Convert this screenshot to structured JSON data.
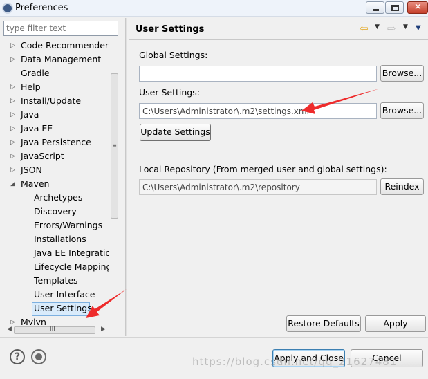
{
  "window": {
    "title": "Preferences"
  },
  "sidebar": {
    "filter_placeholder": "type filter text",
    "items": [
      {
        "label": "Code Recommenders",
        "arrow": "▷"
      },
      {
        "label": "Data Management",
        "arrow": "▷"
      },
      {
        "label": "Gradle",
        "arrow": ""
      },
      {
        "label": "Help",
        "arrow": "▷"
      },
      {
        "label": "Install/Update",
        "arrow": "▷"
      },
      {
        "label": "Java",
        "arrow": "▷"
      },
      {
        "label": "Java EE",
        "arrow": "▷"
      },
      {
        "label": "Java Persistence",
        "arrow": "▷"
      },
      {
        "label": "JavaScript",
        "arrow": "▷"
      },
      {
        "label": "JSON",
        "arrow": "▷"
      },
      {
        "label": "Maven",
        "arrow": "◢"
      },
      {
        "label": "Archetypes",
        "arrow": ""
      },
      {
        "label": "Discovery",
        "arrow": ""
      },
      {
        "label": "Errors/Warnings",
        "arrow": ""
      },
      {
        "label": "Installations",
        "arrow": ""
      },
      {
        "label": "Java EE Integration",
        "arrow": ""
      },
      {
        "label": "Lifecycle Mappings",
        "arrow": ""
      },
      {
        "label": "Templates",
        "arrow": ""
      },
      {
        "label": "User Interface",
        "arrow": ""
      },
      {
        "label": "User Settings",
        "arrow": ""
      },
      {
        "label": "Mylyn",
        "arrow": "▷"
      }
    ],
    "selected": "User Settings"
  },
  "main": {
    "page_title": "User Settings",
    "global_settings_label": "Global Settings:",
    "global_settings_value": "",
    "browse_label": "Browse...",
    "user_settings_label": "User Settings:",
    "user_settings_value": "C:\\Users\\Administrator\\.m2\\settings.xml",
    "update_settings_label": "Update Settings",
    "local_repo_label": "Local Repository (From merged user and global settings):",
    "local_repo_value": "C:\\Users\\Administrator\\.m2\\repository",
    "reindex_label": "Reindex",
    "restore_defaults_label": "Restore Defaults",
    "apply_label": "Apply"
  },
  "footer": {
    "apply_close_label": "Apply and Close",
    "cancel_label": "Cancel",
    "watermark": "https://blog.csdn.net/qq_21627481"
  },
  "icons": {
    "app": "eclipse-icon",
    "help": "help-icon",
    "prefs": "preferences-io-icon",
    "back": "back-arrow-icon",
    "forward": "forward-arrow-icon",
    "menu": "view-menu-icon"
  },
  "colors": {
    "selection": "#d9ebfb",
    "annotation_arrow": "#ee2b2b",
    "back_arrow": "#e3a51a"
  }
}
